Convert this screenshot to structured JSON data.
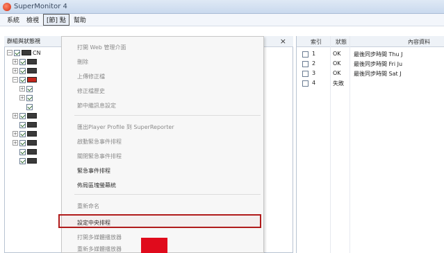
{
  "window": {
    "title": "SuperMonitor 4"
  },
  "menubar": {
    "items": [
      {
        "label": "系統",
        "open": false
      },
      {
        "label": "檢視",
        "open": false
      },
      {
        "label": "[節] 點",
        "open": true
      },
      {
        "label": "幫助",
        "open": false
      }
    ]
  },
  "left_panel": {
    "header": "群組與狀態視",
    "close_symbol": "×"
  },
  "tree": [
    {
      "label": "CN",
      "expander": "−",
      "checked": true,
      "red": false
    },
    {
      "label": "",
      "expander": "+",
      "checked": true,
      "red": false
    },
    {
      "label": "",
      "expander": "+",
      "checked": true,
      "red": false
    },
    {
      "label": "",
      "expander": "−",
      "checked": true,
      "red": true
    },
    {
      "label": "",
      "expander": "+",
      "checked": true,
      "red": false
    },
    {
      "label": "",
      "expander": "+",
      "checked": true,
      "red": false
    },
    {
      "label": "",
      "expander": "",
      "checked": true,
      "red": false
    },
    {
      "label": "",
      "expander": "+",
      "checked": true,
      "red": false
    },
    {
      "label": "",
      "expander": "",
      "checked": true,
      "red": false
    },
    {
      "label": "",
      "expander": "+",
      "checked": true,
      "red": false
    },
    {
      "label": "",
      "expander": "+",
      "checked": true,
      "red": false
    },
    {
      "label": "",
      "expander": "",
      "checked": true,
      "red": false
    },
    {
      "label": "",
      "expander": "",
      "checked": true,
      "red": false
    }
  ],
  "context_menu": {
    "items": [
      {
        "label": "打開 Web 管理介面",
        "strong": false
      },
      {
        "label": "刪除",
        "strong": false
      },
      {
        "label": "上傳修正檔",
        "strong": false
      },
      {
        "label": "修正檔歷史",
        "strong": false
      },
      {
        "label": "節中繼訊息設定",
        "strong": false
      },
      {
        "label": "匯出Player Profile 到 SuperReporter",
        "strong": false
      },
      {
        "label": "啟動緊急事件排程",
        "strong": false
      },
      {
        "label": "關閉緊急事件排程",
        "strong": false
      },
      {
        "label": "緊急事件排程",
        "strong": true
      },
      {
        "label": "佈局區塊螢幕統",
        "strong": true
      },
      {
        "label": "重新命名",
        "strong": false
      },
      {
        "label": "設定中央排程",
        "strong": true
      },
      {
        "label": "打開多媒體播放器",
        "strong": false
      },
      {
        "label": "重新多媒體播放器",
        "strong": false
      }
    ],
    "highlighted": "設定中央排程"
  },
  "right_panel": {
    "columns": [
      "索引",
      "狀態",
      "內容資料"
    ],
    "rows": [
      {
        "index": "1",
        "status": "OK",
        "desc": "最後同步時間 Thu J"
      },
      {
        "index": "2",
        "status": "OK",
        "desc": "最後同步時間 Fri Ju"
      },
      {
        "index": "3",
        "status": "OK",
        "desc": "最後同步時間 Sat J"
      },
      {
        "index": "4",
        "status": "失敗",
        "desc": ""
      }
    ]
  },
  "colors": {
    "highlight": "#b01a1a",
    "red_block": "#e00b1c"
  }
}
